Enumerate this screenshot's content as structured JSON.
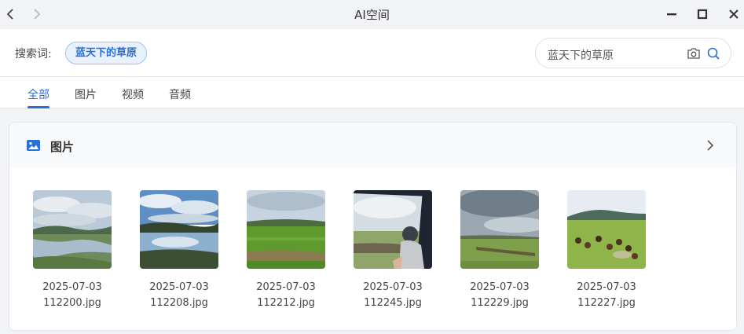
{
  "window": {
    "title": "AI空间"
  },
  "search": {
    "label": "搜索词:",
    "chip": "蓝天下的草原",
    "value": "蓝天下的草原"
  },
  "tabs": [
    {
      "label": "全部",
      "active": true
    },
    {
      "label": "图片",
      "active": false
    },
    {
      "label": "视频",
      "active": false
    },
    {
      "label": "音频",
      "active": false
    }
  ],
  "section": {
    "title": "图片"
  },
  "images": [
    {
      "date": "2025-07-03",
      "name": "112200.jpg"
    },
    {
      "date": "2025-07-03",
      "name": "112208.jpg"
    },
    {
      "date": "2025-07-03",
      "name": "112212.jpg"
    },
    {
      "date": "2025-07-03",
      "name": "112245.jpg"
    },
    {
      "date": "2025-07-03",
      "name": "112229.jpg"
    },
    {
      "date": "2025-07-03",
      "name": "112227.jpg"
    }
  ],
  "colors": {
    "accent": "#2b6fd6",
    "chip_bg": "#e8f1fc"
  }
}
